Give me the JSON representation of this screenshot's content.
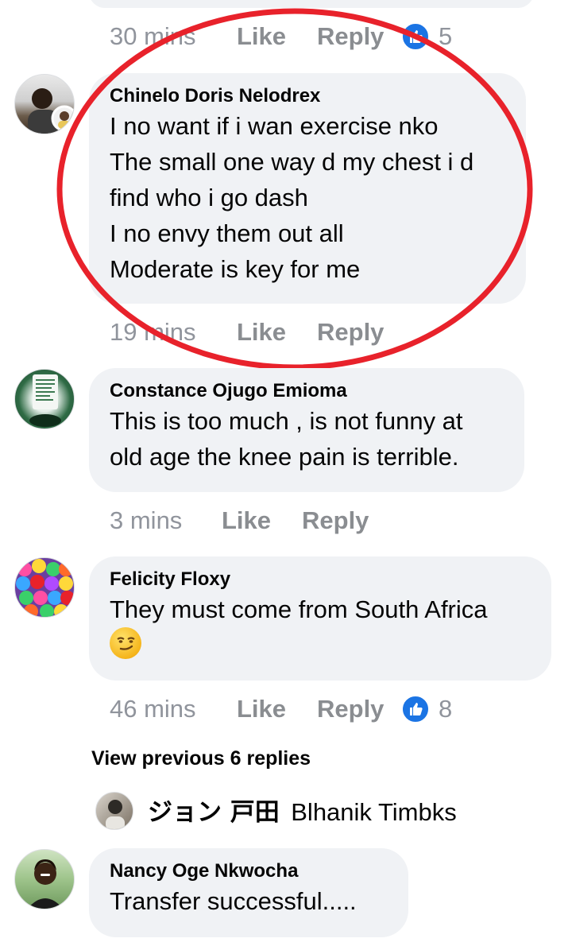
{
  "top_meta": {
    "time": "30 mins",
    "like": "Like",
    "reply": "Reply",
    "reactions": "5"
  },
  "comments": [
    {
      "author": "Chinelo Doris Nelodrex",
      "text": "I no want if i wan exercise nko\nThe small one way d my chest i d\nfind who i go dash\nI no envy them out all\nModerate is key for me",
      "time": "19 mins",
      "like": "Like",
      "reply": "Reply"
    },
    {
      "author": "Constance Ojugo Emioma",
      "text": "This is too much ,  is not funny at\nold age the knee pain is terrible.",
      "time": "3 mins",
      "like": "Like",
      "reply": "Reply"
    },
    {
      "author": "Felicity Floxy",
      "text": "They must come from South Africa",
      "emoji": "smirk-emoji",
      "time": "46 mins",
      "like": "Like",
      "reply": "Reply",
      "reactions": "8"
    },
    {
      "author": "Nancy Oge Nkwocha",
      "text": "Transfer successful....."
    }
  ],
  "view_previous": "View previous 6 replies",
  "reply_preview": {
    "author": "ジョン 戸田",
    "text": "Blhanik Timbks"
  },
  "colors": {
    "like_blue": "#1b74e4",
    "highlight_circle": "#e8222b",
    "bubble": "#f0f2f5",
    "meta": "#90949c"
  }
}
